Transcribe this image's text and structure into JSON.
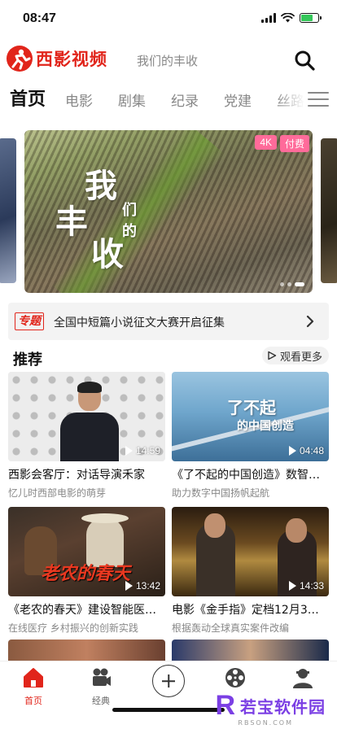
{
  "status_bar": {
    "time": "08:47",
    "battery_level": 0.7
  },
  "header": {
    "logo_text": "西影视频",
    "hint": "我们的丰收"
  },
  "tabs": [
    {
      "label": "首页",
      "active": true
    },
    {
      "label": "电影"
    },
    {
      "label": "剧集"
    },
    {
      "label": "纪录"
    },
    {
      "label": "党建"
    },
    {
      "label": "丝路"
    }
  ],
  "banner": {
    "title_1": "我",
    "title_2": "丰",
    "title_3": "收",
    "title_small": "们的",
    "badge_4k": "4K",
    "badge_pay": "付费"
  },
  "promo": {
    "tag": "专题",
    "text": "全国中短篇小说征文大赛开启征集"
  },
  "recommend": {
    "title": "推荐",
    "more_label": "观看更多",
    "items": [
      {
        "title": "西影会客厅：对话导演禾家",
        "subtitle": "忆儿时西部电影的萌芽",
        "duration": "14:59"
      },
      {
        "title": "《了不起的中国创造》数智…",
        "subtitle": "助力数字中国扬帆起航",
        "duration": "04:48",
        "thumb_text": "了不起",
        "thumb_text2": "的中国创造"
      },
      {
        "title": "《老农的春天》建设智能医…",
        "subtitle": "在线医疗 乡村振兴的创新实践",
        "duration": "13:42",
        "thumb_text": "老农的春天"
      },
      {
        "title": "电影《金手指》定档12月3…",
        "subtitle": "根据轰动全球真实案件改编",
        "duration": "14:33"
      }
    ]
  },
  "bottom_nav": [
    {
      "label": "首页",
      "icon": "home-icon",
      "active": true
    },
    {
      "label": "经典",
      "icon": "film-camera-icon"
    },
    {
      "label": "",
      "icon": "plus-icon"
    },
    {
      "label": "",
      "icon": "film-reel-icon"
    },
    {
      "label": "",
      "icon": "profile-icon"
    }
  ],
  "watermark": {
    "logo": "R",
    "text": "若宝软件园",
    "sub": "RBSON.COM"
  },
  "colors": {
    "brand": "#e1251b",
    "tag_pink": "#ff6b9a"
  }
}
